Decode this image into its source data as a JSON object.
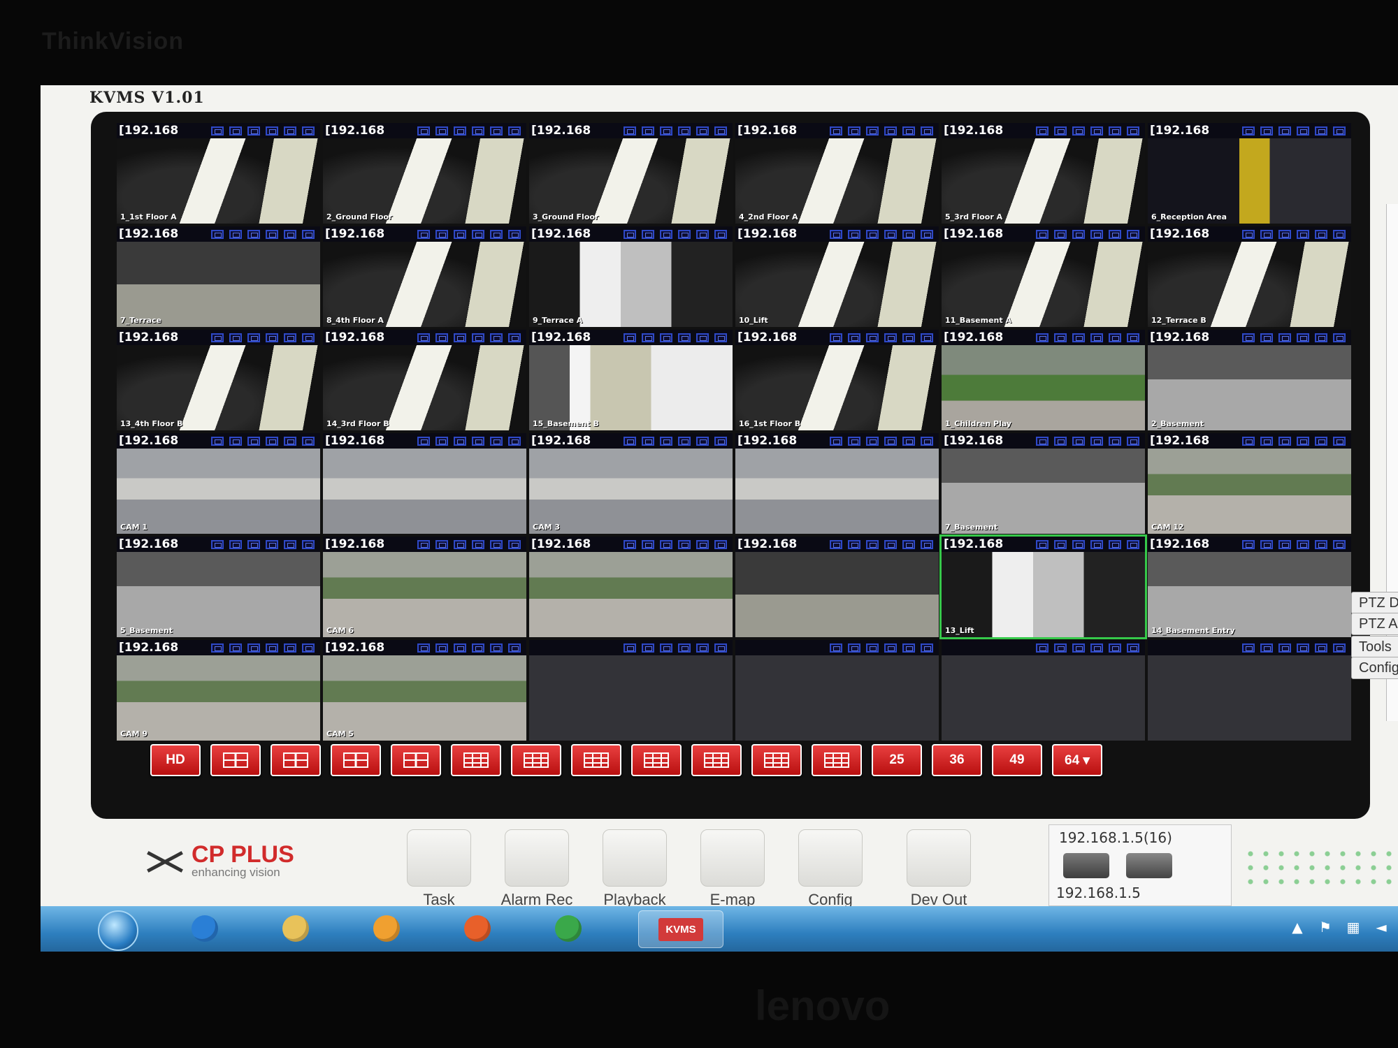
{
  "bezel": {
    "brand": "ThinkVision",
    "logo": "lenovo"
  },
  "app": {
    "title": "KVMS  V1.01"
  },
  "grid": {
    "columns": 6,
    "cells": [
      {
        "ip": "[192.168",
        "label": "1_1st Floor A",
        "scene": "v-stair"
      },
      {
        "ip": "[192.168",
        "label": "2_Ground Floor",
        "scene": "v-stair"
      },
      {
        "ip": "[192.168",
        "label": "3_Ground Floor",
        "scene": "v-stair"
      },
      {
        "ip": "[192.168",
        "label": "4_2nd Floor A",
        "scene": "v-stair"
      },
      {
        "ip": "[192.168",
        "label": "5_3rd Floor A",
        "scene": "v-stair"
      },
      {
        "ip": "[192.168",
        "label": "6_Reception Area",
        "scene": "v-yellow"
      },
      {
        "ip": "[192.168",
        "label": "7_Terrace",
        "scene": "v-lobby"
      },
      {
        "ip": "[192.168",
        "label": "8_4th Floor A",
        "scene": "v-stair"
      },
      {
        "ip": "[192.168",
        "label": "9_Terrace A",
        "scene": "v-corr"
      },
      {
        "ip": "[192.168",
        "label": "10_Lift",
        "scene": "v-stair"
      },
      {
        "ip": "[192.168",
        "label": "11_Basement A",
        "scene": "v-stair"
      },
      {
        "ip": "[192.168",
        "label": "12_Terrace B",
        "scene": "v-stair"
      },
      {
        "ip": "[192.168",
        "label": "13_4th Floor B",
        "scene": "v-stair"
      },
      {
        "ip": "[192.168",
        "label": "14_3rd Floor B",
        "scene": "v-stair"
      },
      {
        "ip": "[192.168",
        "label": "15_Basement B",
        "scene": "v-lift"
      },
      {
        "ip": "[192.168",
        "label": "16_1st Floor B",
        "scene": "v-stair"
      },
      {
        "ip": "[192.168",
        "label": "1_Children Play",
        "scene": "v-green"
      },
      {
        "ip": "[192.168",
        "label": "2_Basement",
        "scene": "v-base"
      },
      {
        "ip": "[192.168",
        "label": "CAM 1",
        "scene": "v-roof"
      },
      {
        "ip": "[192.168",
        "label": "",
        "scene": "v-roof"
      },
      {
        "ip": "[192.168",
        "label": "CAM 3",
        "scene": "v-roof"
      },
      {
        "ip": "[192.168",
        "label": "",
        "scene": "v-roof"
      },
      {
        "ip": "[192.168",
        "label": "7_Basement",
        "scene": "v-base"
      },
      {
        "ip": "[192.168",
        "label": "CAM 12",
        "scene": "v-park"
      },
      {
        "ip": "[192.168",
        "label": "5_Basement",
        "scene": "v-base"
      },
      {
        "ip": "[192.168",
        "label": "CAM 6",
        "scene": "v-park"
      },
      {
        "ip": "[192.168",
        "label": "",
        "scene": "v-park"
      },
      {
        "ip": "[192.168",
        "label": "",
        "scene": "v-lobby"
      },
      {
        "ip": "[192.168",
        "label": "13_Lift",
        "scene": "v-corr",
        "selected": true
      },
      {
        "ip": "[192.168",
        "label": "14_Basement Entry",
        "scene": "v-base"
      },
      {
        "ip": "[192.168",
        "label": "CAM 9",
        "scene": "v-park"
      },
      {
        "ip": "[192.168",
        "label": "CAM 5",
        "scene": "v-park"
      }
    ],
    "empty_count": 4
  },
  "layout_buttons": [
    "HD",
    "",
    "",
    "",
    "",
    "",
    "",
    "",
    "",
    "",
    "",
    "",
    "25",
    "36",
    "49",
    "64 ▾"
  ],
  "right_panel": [
    "PTZ D",
    "PTZ A",
    "Tools",
    "Config"
  ],
  "toolbar": {
    "brand_name": "CP PLUS",
    "brand_tagline": "enhancing vision",
    "tools": [
      {
        "label": "Task",
        "icon": "camera-task-icon"
      },
      {
        "label": "Alarm Rec",
        "icon": "alarm-siren-icon"
      },
      {
        "label": "Playback",
        "icon": "clapperboard-icon"
      },
      {
        "label": "E-map",
        "icon": "map-pin-icon"
      },
      {
        "label": "Config",
        "icon": "config-check-icon"
      },
      {
        "label": "Dev Out .CFG",
        "icon": "export-config-icon"
      }
    ],
    "device_ip_top": "192.168.1.5(16)",
    "device_ip_bottom": "192.168.1.5"
  },
  "taskbar": {
    "apps": [
      "Internet Explorer",
      "Explorer",
      "Media Player",
      "Firefox",
      "Chrome",
      "KVMS"
    ],
    "kvms_label": "KVMS"
  },
  "colors": {
    "button_red": "#d32020",
    "selected_cell": "#36c94a",
    "icon_blue": "#2e49c9",
    "brand_red": "#d12b2b"
  }
}
